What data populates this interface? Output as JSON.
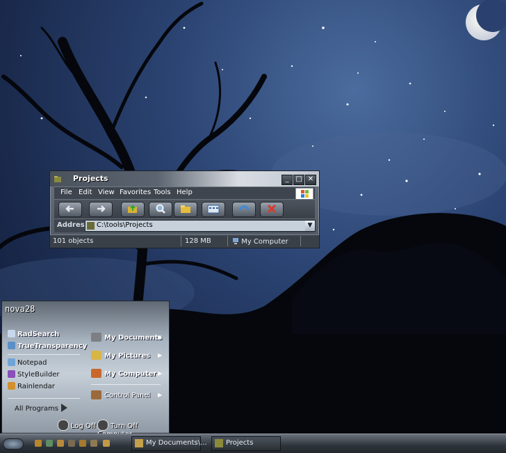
{
  "window": {
    "title": "Projects",
    "menu": [
      "File",
      "Edit",
      "View",
      "Favorites",
      "Tools",
      "Help"
    ],
    "address_label": "Address",
    "address_value": "C:\\tools\\Projects",
    "status": {
      "objects": "101 objects",
      "size": "128 MB",
      "location": "My Computer"
    }
  },
  "start_menu": {
    "user": "nova28",
    "pinned": [
      {
        "label": "RadSearch",
        "icon": "search-icon"
      },
      {
        "label": "TrueTransparency",
        "icon": "app-icon"
      }
    ],
    "recent": [
      {
        "label": "Notepad",
        "icon": "notepad-icon"
      },
      {
        "label": "StyleBuilder",
        "icon": "stylebuilder-icon"
      },
      {
        "label": "Rainlendar",
        "icon": "calendar-icon"
      }
    ],
    "all_programs": "All Programs",
    "right_items": [
      {
        "label": "My Documents",
        "icon": "folder-icon"
      },
      {
        "label": "My Pictures",
        "icon": "pictures-icon"
      },
      {
        "label": "My Computer",
        "icon": "computer-icon"
      },
      {
        "label": "Control Panel",
        "icon": "control-panel-icon"
      }
    ],
    "log_off": "Log Off",
    "turn_off": "Turn Off Computer"
  },
  "taskbar": {
    "tasks": [
      {
        "label": "My Documents\\...",
        "icon": "folder-icon"
      },
      {
        "label": "Projects",
        "icon": "folder-icon"
      }
    ]
  },
  "colors": {
    "sky": "#2c4574",
    "window_chrome": "#4f5762",
    "taskbar": "#2e343b"
  }
}
